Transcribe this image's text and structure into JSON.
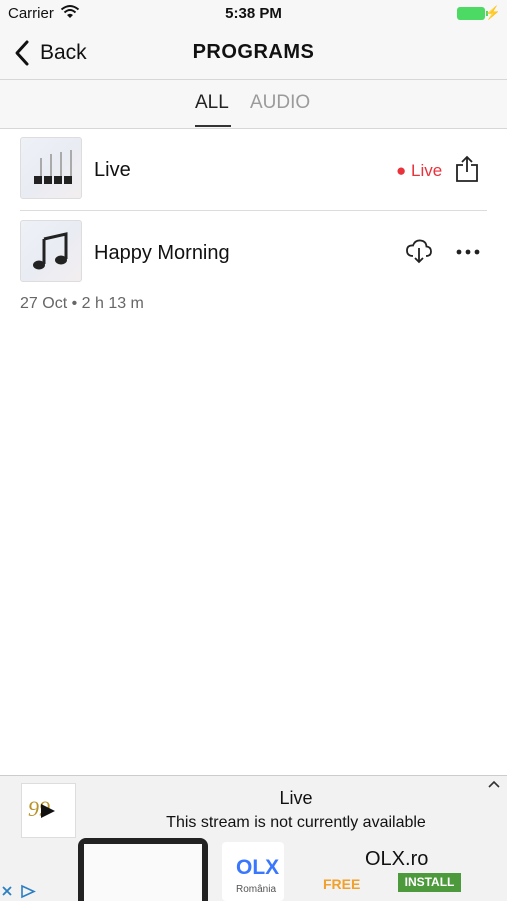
{
  "status_bar": {
    "carrier": "Carrier",
    "time": "5:38 PM"
  },
  "nav": {
    "back_label": "Back",
    "title": "PROGRAMS"
  },
  "tabs": [
    {
      "label": "ALL",
      "selected": true
    },
    {
      "label": "AUDIO",
      "selected": false
    }
  ],
  "programs": [
    {
      "title": "Live",
      "badge": "Live",
      "icon": "share-icon"
    },
    {
      "title": "Happy Morning",
      "meta": "27 Oct • 2 h 13 m",
      "icon": "download-cloud-icon"
    }
  ],
  "ad": {
    "title": "Live",
    "subtitle": "This stream is not currently available",
    "app_name": "OLX.ro",
    "logo_text": "OLX",
    "logo_sub": "România",
    "price": "FREE",
    "install_label": "INSTALL"
  },
  "colors": {
    "live_red": "#e8323c",
    "accent_green": "#4c9a3c",
    "battery": "#4cd964"
  }
}
